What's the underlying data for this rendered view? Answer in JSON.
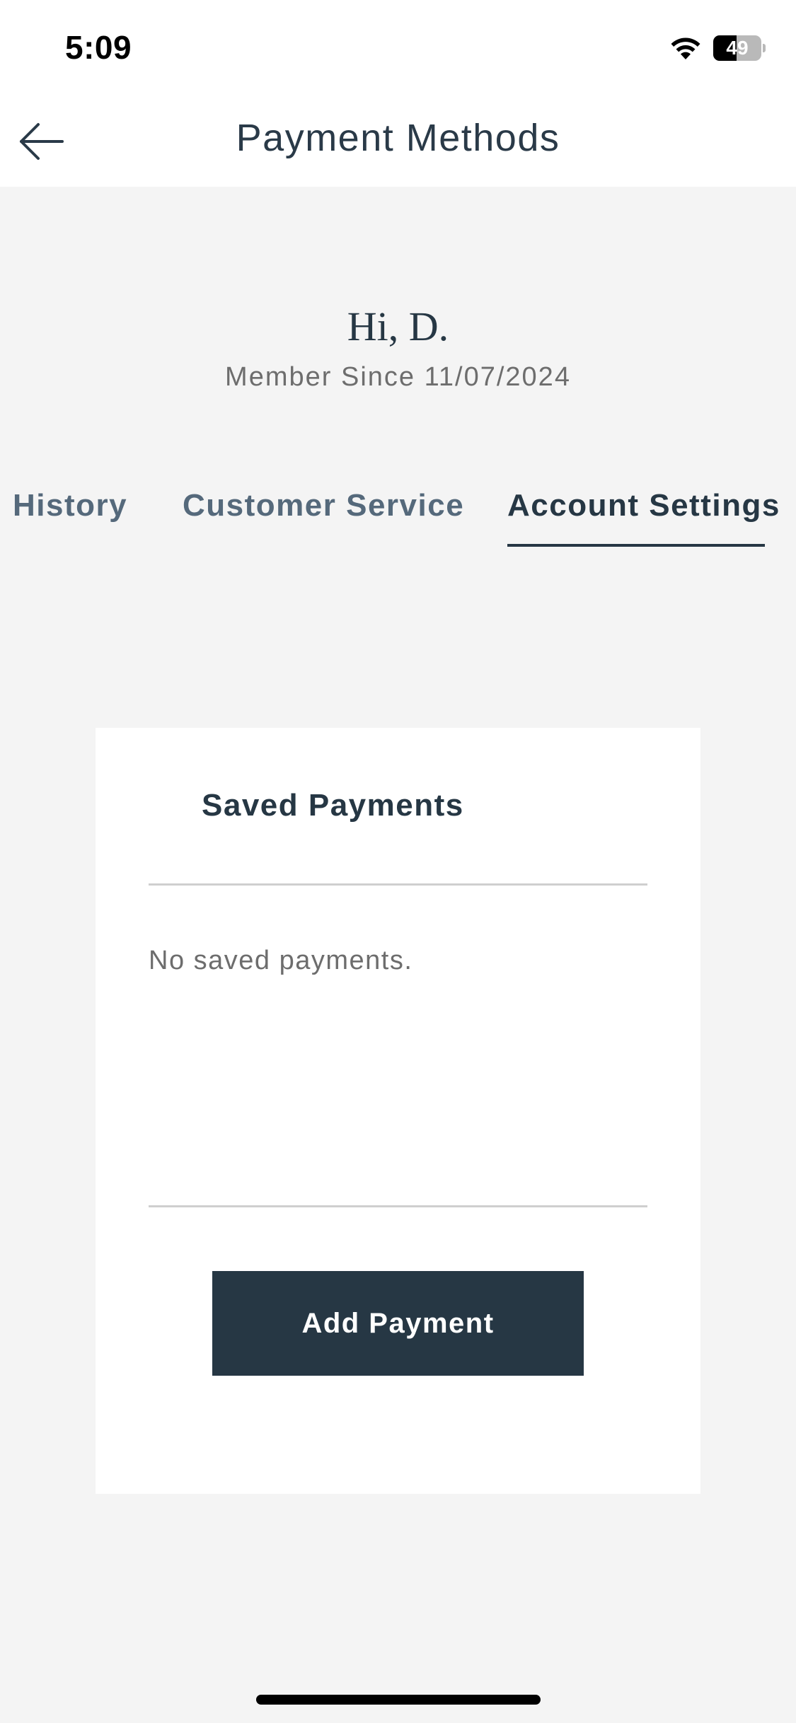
{
  "status_bar": {
    "time": "5:09",
    "battery_level": "49",
    "battery_fraction": 0.49
  },
  "header": {
    "title": "Payment Methods",
    "back_icon": "arrow-left-icon"
  },
  "profile": {
    "greeting": "Hi, D.",
    "member_since": "Member Since 11/07/2024"
  },
  "tabs": [
    {
      "label": "History",
      "active": false
    },
    {
      "label": "Customer Service",
      "active": false
    },
    {
      "label": "Account Settings",
      "active": true
    }
  ],
  "saved_payments": {
    "title": "Saved Payments",
    "empty_message": "No saved payments.",
    "add_button_label": "Add Payment"
  },
  "colors": {
    "primary": "#263744",
    "background": "#f4f4f4",
    "card": "#ffffff",
    "muted_text": "#6d6d6d",
    "inactive_tab": "#55697b"
  }
}
